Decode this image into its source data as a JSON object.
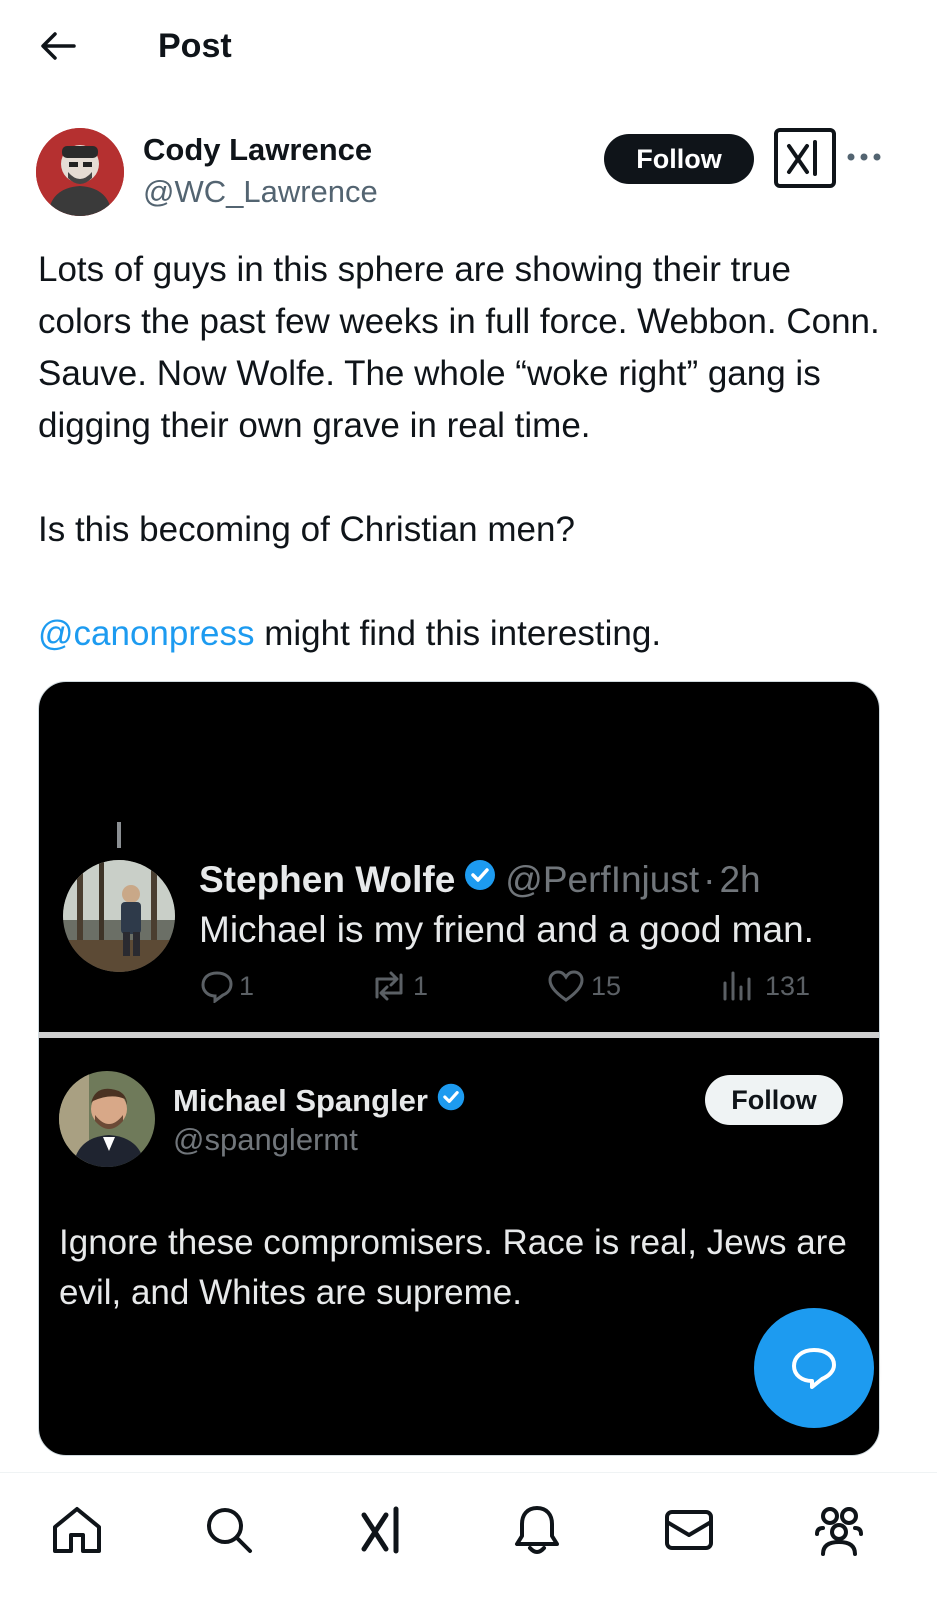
{
  "header": {
    "title": "Post",
    "back_icon": "arrow-left-icon"
  },
  "post": {
    "author_name": "Cody Lawrence",
    "author_handle": "@WC_Lawrence",
    "follow_label": "Follow",
    "paragraphs": [
      "Lots of guys in this sphere are showing their true colors the past few weeks in full force. Webbon. Conn. Sauve. Now Wolfe. The whole “woke right” gang is digging their own grave in real time.",
      "Is this becoming of Christian men?"
    ],
    "mention": "@canonpress",
    "mention_suffix": " might find this interesting."
  },
  "media": {
    "quote1": {
      "name": "Stephen Wolfe",
      "handle": "@PerfInjust",
      "separator": "·",
      "time": "2h",
      "text": "Michael is my friend and a good man.",
      "replies": "1",
      "reposts": "1",
      "likes": "15",
      "views": "131"
    },
    "quote2": {
      "name": "Michael Spangler",
      "handle": "@spanglermt",
      "follow_label": "Follow",
      "text": "Ignore these compromisers. Race is real, Jews are evil, and Whites are supreme."
    }
  },
  "colors": {
    "accent": "#1d9bf0",
    "text": "#0f1419",
    "muted": "#536471",
    "media_bg": "#000000"
  },
  "nav": {
    "items": [
      "home-icon",
      "search-icon",
      "grok-icon",
      "notifications-icon",
      "messages-icon",
      "communities-icon"
    ]
  }
}
